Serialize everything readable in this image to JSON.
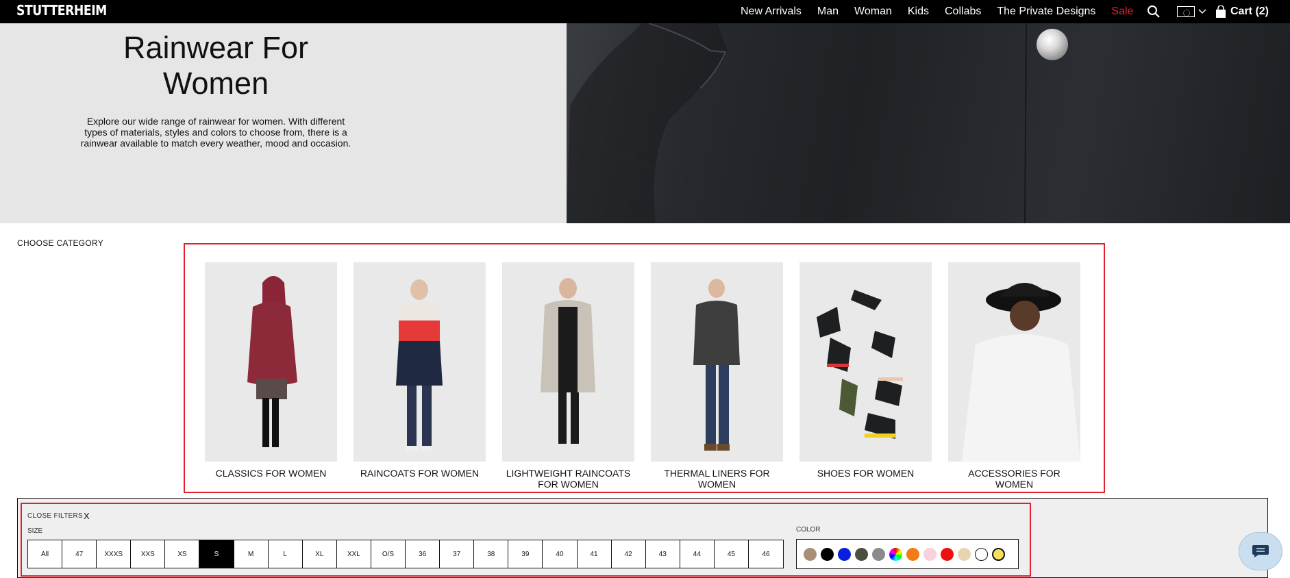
{
  "header": {
    "logo": "STUTTERHEIM",
    "nav": [
      "New Arrivals",
      "Man",
      "Woman",
      "Kids",
      "Collabs",
      "The Private Designs"
    ],
    "sale": "Sale",
    "cart": "Cart (2)"
  },
  "hero": {
    "title_line1": "Rainwear For",
    "title_line2": "Women",
    "description": "Explore our wide range of rainwear for women. With different types of materials, styles and colors to choose from, there is a rainwear available to match every weather, mood and occasion."
  },
  "categories": {
    "heading": "CHOOSE CATEGORY",
    "items": [
      {
        "label": "CLASSICS FOR WOMEN",
        "icon": "woman-red-coat-photo"
      },
      {
        "label": "RAINCOATS FOR WOMEN",
        "icon": "woman-striped-raincoat-photo"
      },
      {
        "label": "LIGHTWEIGHT RAINCOATS FOR WOMEN",
        "icon": "woman-beige-raincoat-photo"
      },
      {
        "label": "THERMAL LINERS FOR WOMEN",
        "icon": "woman-quilted-jacket-photo"
      },
      {
        "label": "SHOES FOR WOMEN",
        "icon": "rain-boots-photo"
      },
      {
        "label": "ACCESSORIES FOR WOMEN",
        "icon": "bucket-hat-photo"
      }
    ]
  },
  "filters": {
    "close_label": "CLOSE FILTERS",
    "close_x": "X",
    "size_label": "SIZE",
    "sizes": [
      "All",
      "47",
      "XXXS",
      "XXS",
      "XS",
      "S",
      "M",
      "L",
      "XL",
      "XXL",
      "O/S",
      "36",
      "37",
      "38",
      "39",
      "40",
      "41",
      "42",
      "43",
      "44",
      "45",
      "46"
    ],
    "selected_size": "S",
    "color_label": "COLOR",
    "colors": [
      "#a89074",
      "#000000",
      "#0a1ee0",
      "#4b4f40",
      "#8a8a8a",
      "multicolor",
      "#f07c18",
      "#f9d0dc",
      "#ee1111",
      "#e8d4b0",
      "#ffffff",
      "#f2e060"
    ],
    "selected_color": "#f2e060"
  },
  "icons": {
    "search": "search-icon",
    "region_flag": "eu-flag-icon",
    "region_chevron": "chevron-down-icon",
    "cart_bag": "shopping-bag-icon",
    "chat": "chat-icon"
  }
}
